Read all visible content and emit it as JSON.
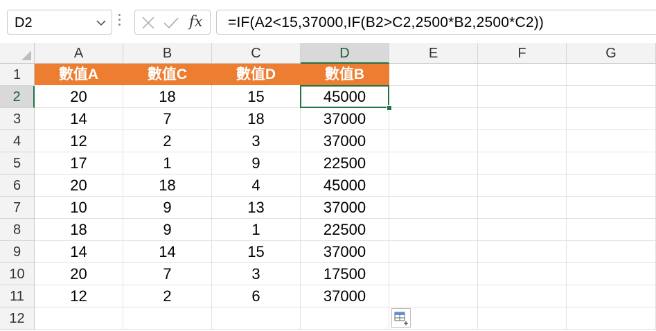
{
  "namebox": {
    "value": "D2"
  },
  "formula": {
    "text": "=IF(A2<15,37000,IF(B2>C2,2500*B2,2500*C2))",
    "fx_label": "fx"
  },
  "columns": [
    "A",
    "B",
    "C",
    "D",
    "E",
    "F",
    "G"
  ],
  "selected_column": "D",
  "rows": [
    "1",
    "2",
    "3",
    "4",
    "5",
    "6",
    "7",
    "8",
    "9",
    "10",
    "11",
    "12"
  ],
  "selected_row": "2",
  "header_row": [
    "數值A",
    "數值C",
    "數值D",
    "數值B"
  ],
  "data_rows": [
    [
      "20",
      "18",
      "15",
      "45000"
    ],
    [
      "14",
      "7",
      "18",
      "37000"
    ],
    [
      "12",
      "2",
      "3",
      "37000"
    ],
    [
      "17",
      "1",
      "9",
      "22500"
    ],
    [
      "20",
      "18",
      "4",
      "45000"
    ],
    [
      "10",
      "9",
      "13",
      "37000"
    ],
    [
      "18",
      "9",
      "1",
      "22500"
    ],
    [
      "14",
      "14",
      "15",
      "37000"
    ],
    [
      "20",
      "7",
      "3",
      "17500"
    ],
    [
      "12",
      "2",
      "6",
      "37000"
    ]
  ],
  "colors": {
    "header_fill": "#ed7d31",
    "header_text": "#ffffff",
    "selection": "#217346"
  },
  "icons": {
    "cancel": "x-icon",
    "enter": "check-icon",
    "quick_analysis": "quick-analysis-icon"
  }
}
